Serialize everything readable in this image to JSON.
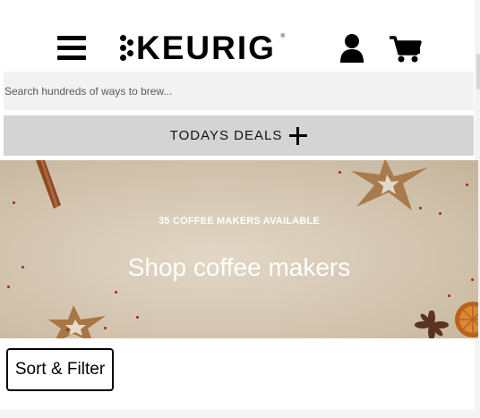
{
  "header": {
    "logo_text": "KEURIG",
    "logo_mark": "®",
    "menu_icon": "hamburger-menu-icon",
    "account_icon": "account-person-icon",
    "cart_icon": "shopping-cart-icon"
  },
  "search": {
    "placeholder": "Search hundreds of ways to brew...",
    "value": ""
  },
  "deals": {
    "label": "TODAYS DEALS",
    "icon": "plus-icon"
  },
  "hero": {
    "count_text": "35 COFFEE MAKERS AVAILABLE",
    "headline": "Shop coffee makers"
  },
  "filters": {
    "sort_label": "Sort & Filter"
  },
  "colors": {
    "search_bg": "#f2f2f2",
    "deals_bg": "#d4d4d4",
    "hero_bg": "#d3c5b0",
    "text": "#000000"
  }
}
